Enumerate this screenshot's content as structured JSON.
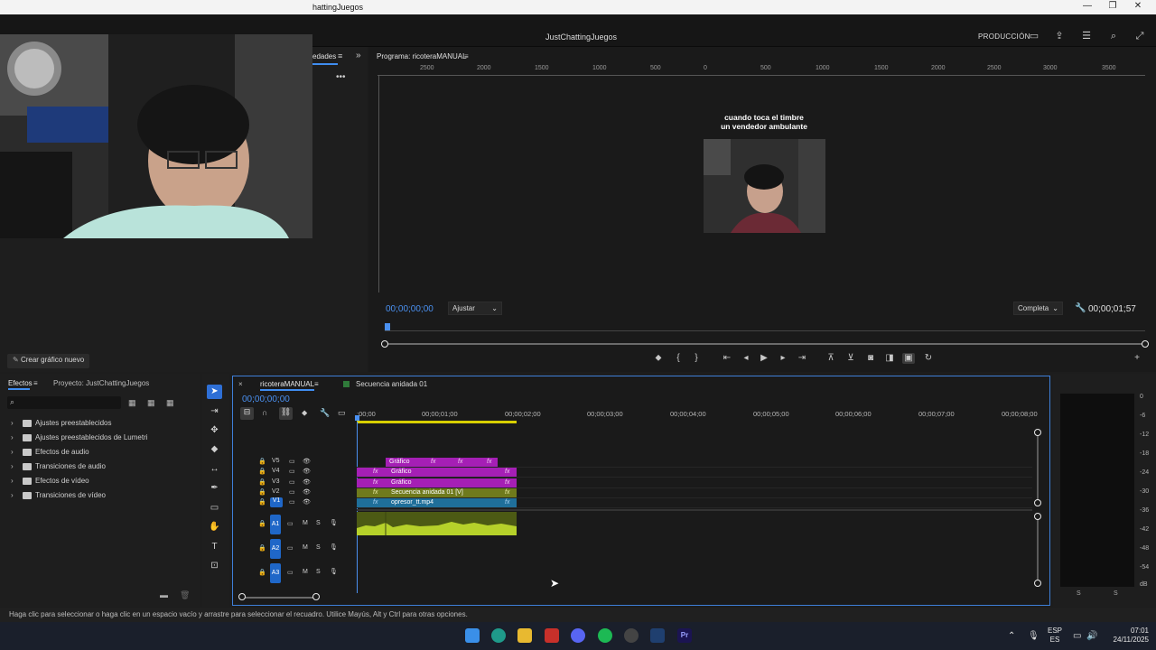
{
  "window": {
    "title_fragment": "hattingJuegos",
    "controls": [
      "—",
      "❐",
      "✕"
    ]
  },
  "app_header": {
    "project_name": "JustChattingJuegos",
    "workspace": "PRODUCCIÓN"
  },
  "left_panel": {
    "tab_fragment": "edades",
    "new_graphic_button": "Crear gráfico nuevo"
  },
  "program_monitor": {
    "title": "Programa: ricoteraMANUAL",
    "ruler_labels": [
      "2500",
      "2000",
      "1500",
      "1000",
      "500",
      "0",
      "500",
      "1000",
      "1500",
      "2000",
      "2500",
      "3000",
      "3500"
    ],
    "caption_line1": "cuando toca el timbre",
    "caption_line2": "un vendedor ambulante",
    "timecode": "00;00;00;00",
    "fit_select": "Ajustar",
    "quality_select": "Completa",
    "duration": "00;00;01;57"
  },
  "effects_panel": {
    "tab_effects": "Efectos",
    "tab_project": "Proyecto: JustChattingJuegos",
    "items": [
      "Ajustes preestablecidos",
      "Ajustes preestablecidos de Lumetri",
      "Efectos de audio",
      "Transiciones de audio",
      "Efectos de vídeo",
      "Transiciones de vídeo"
    ]
  },
  "timeline": {
    "tab_sequence": "ricoteraMANUAL",
    "tab_nested": "Secuencia anidada 01",
    "timecode": "00;00;00;00",
    "ruler_labels": [
      ":00;00",
      "00;00;01;00",
      "00;00;02;00",
      "00;00;03;00",
      "00;00;04;00",
      "00;00;05;00",
      "00;00;06;00",
      "00;00;07;00",
      "00;00;08;00"
    ],
    "video_tracks": [
      "V5",
      "V4",
      "V3",
      "V2",
      "V1"
    ],
    "audio_tracks": [
      "A1",
      "A2",
      "A3"
    ],
    "clip_graphic": "Gráfico",
    "clip_nested": "Secuencia anidada 01 [V]",
    "clip_video": "opresor_tt.mp4",
    "fx_label": "fx",
    "mute_label": "M",
    "solo_label": "S"
  },
  "meters": {
    "db_labels": [
      "0",
      "-6",
      "-12",
      "-18",
      "-24",
      "-30",
      "-36",
      "-42",
      "-48",
      "-54",
      "dB"
    ],
    "solo_labels": [
      "S",
      "S"
    ]
  },
  "status_bar": {
    "message": "Haga clic para seleccionar o haga clic en un espacio vacío y arrastre para seleccionar el recuadro. Utilice Mayús, Alt y Ctrl para otras opciones."
  },
  "taskbar": {
    "lang_line1": "ESP",
    "lang_line2": "ES",
    "time": "07:01",
    "date": "24/11/2025"
  },
  "colors": {
    "accent": "#3f8df0",
    "clip_graphic": "#a51fb5",
    "clip_nested": "#6f7a1c",
    "clip_video": "#1f6f9a",
    "audio_clip": "#4c5a14"
  }
}
